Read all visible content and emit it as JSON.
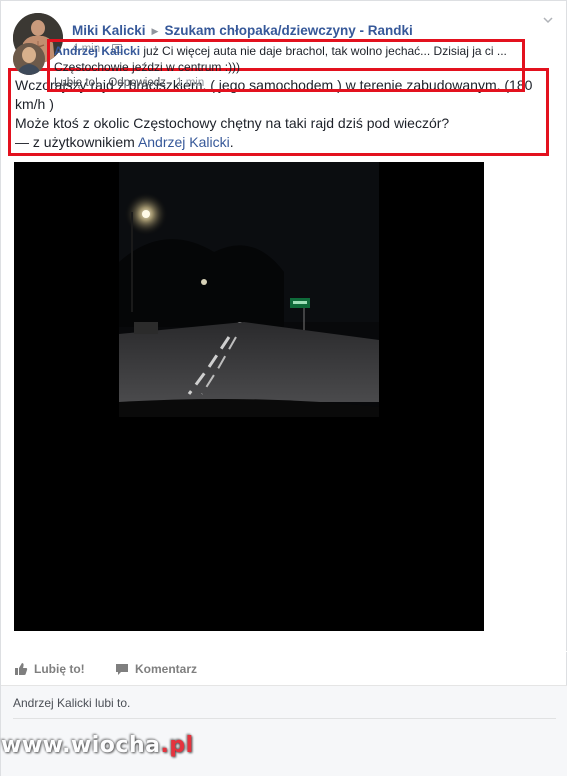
{
  "post": {
    "author": "Miki Kalicki",
    "group": "Szukam chłopaka/dziewczyny - Randki",
    "time": "4 min",
    "text_line1": "Wczorajszy rajd z braciszkiem, ( jego samochodem ) w terenie zabudowanym, (180 km/h )",
    "text_line2": "Może ktoś z okolic Częstochowy chętny na taki rajd dziś pod wieczór?",
    "tag_prefix": "— z użytkownikiem ",
    "tag_name": "Andrzej Kalicki",
    "tag_suffix": "."
  },
  "actions": {
    "like": "Lubię to!",
    "comment": "Komentarz"
  },
  "likes_line": "Andrzej Kalicki lubi to.",
  "comment": {
    "author": "Andrzej Kalicki",
    "text": " już Ci więcej auta nie daje brachol, tak wolno jechać... Dzisiaj ja ci ... Częstochowie jeździ w centrum :)))",
    "like": "Lubię to!",
    "reply": "Odpowiedz",
    "time": "1 min"
  },
  "watermark": {
    "prefix": "www.",
    "name": "wiocha",
    "suffix": ".pl"
  },
  "colors": {
    "highlight": "#e3111e",
    "link": "#365899"
  },
  "icons": [
    "chevron-down-icon",
    "audience-icon",
    "like-icon",
    "comment-icon"
  ]
}
